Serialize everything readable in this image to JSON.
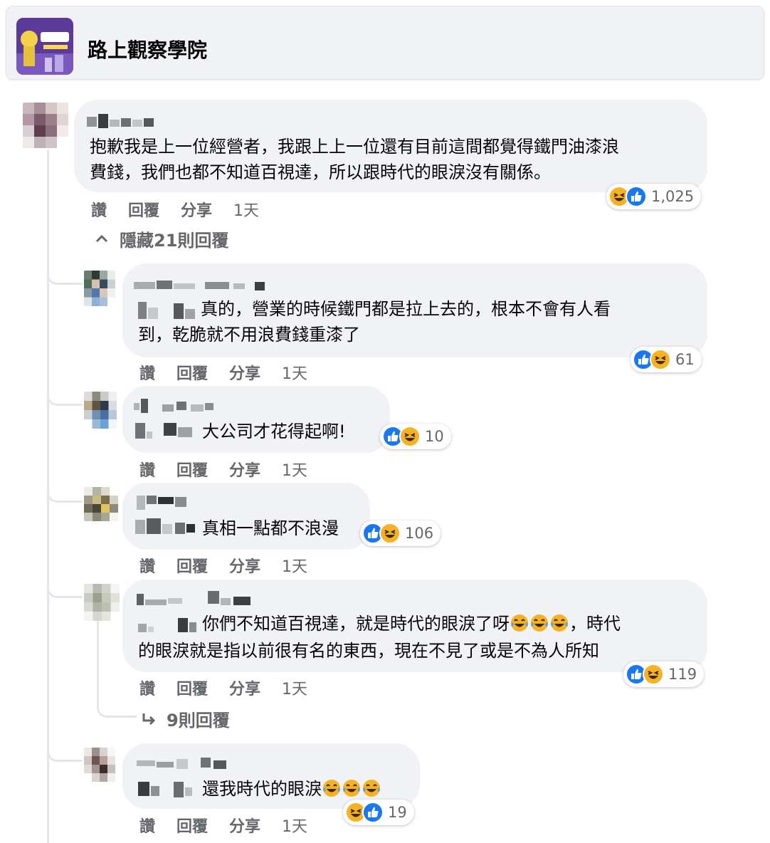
{
  "page": {
    "name": "路上觀察學院"
  },
  "main_comment": {
    "text_line1": "抱歉我是上一位經營者，我跟上上一位還有目前這間都覺得鐵門油漆浪",
    "text_line2": "費錢，我們也都不知道百視達，所以跟時代的眼淚沒有關係。",
    "reaction_count": "1,025",
    "actions": {
      "like": "讚",
      "reply": "回覆",
      "share": "分享",
      "time": "1天"
    }
  },
  "hide_replies_label": "隱藏21則回覆",
  "replies": [
    {
      "text_line1": "真的，營業的時候鐵門都是拉上去的，根本不會有人看",
      "text_line2": "到，乾脆就不用浪費錢重漆了",
      "reaction_count": "61",
      "actions": {
        "like": "讚",
        "reply": "回覆",
        "share": "分享",
        "time": "1天"
      }
    },
    {
      "text_line1": "大公司才花得起啊!",
      "reaction_count": "10",
      "actions": {
        "like": "讚",
        "reply": "回覆",
        "share": "分享",
        "time": "1天"
      }
    },
    {
      "text_line1": "真相一點都不浪漫",
      "reaction_count": "106",
      "actions": {
        "like": "讚",
        "reply": "回覆",
        "share": "分享",
        "time": "1天"
      }
    },
    {
      "text_line1": "你們不知道百視達，就是時代的眼淚了呀",
      "text_line1_suffix": "，時代",
      "text_line2": "的眼淚就是指以前很有名的東西，現在不見了或是不為人所知",
      "reaction_count": "119",
      "actions": {
        "like": "讚",
        "reply": "回覆",
        "share": "分享",
        "time": "1天"
      },
      "more_replies_label": "9則回覆"
    },
    {
      "text_line1": "還我時代的眼淚",
      "reaction_count": "19",
      "actions": {
        "like": "讚",
        "reply": "回覆",
        "share": "分享",
        "time": "1天"
      }
    }
  ],
  "colors": {
    "like_blue": "#1877f2",
    "haha_yellow": "#f7b125",
    "bubble_bg": "#f0f2f5",
    "meta_gray": "#65676b"
  },
  "icons": [
    "like-icon",
    "haha-icon",
    "tears-of-joy-emoji",
    "chevron-up-icon",
    "reply-arrow-icon"
  ]
}
